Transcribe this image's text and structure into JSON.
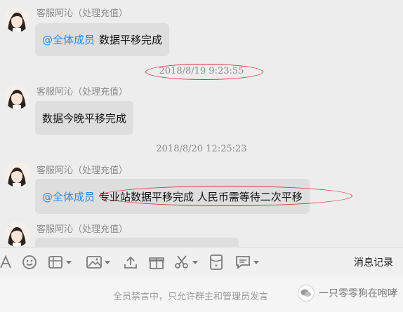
{
  "messages": [
    {
      "sender": "客服阿沁（处理充值）",
      "mention": "@全体成员",
      "text": "数据平移完成"
    },
    {
      "time": "2018/8/19 9:23:55"
    },
    {
      "sender": "客服阿沁（处理充值）",
      "text": "数据今晚平移完成"
    },
    {
      "time": "2018/8/20 12:25:23"
    },
    {
      "sender": "客服阿沁（处理充值）",
      "mention": "@全体成员",
      "text": "专业站数据平移完成 人民币需等待二次平移"
    },
    {
      "sender": "客服阿沁（处理充值）"
    }
  ],
  "toolbar": {
    "icons": [
      "font-icon",
      "emoji-icon",
      "sticker-icon",
      "image-icon",
      "upload-icon",
      "gift-icon",
      "screenshot-icon",
      "redpacket-icon",
      "chat-record-icon"
    ],
    "history_label": "消息记录"
  },
  "footer": {
    "banned_text": "全员禁言中，只允许群主和管理员发言",
    "watermark": "一只零零狗在咆哮"
  },
  "colors": {
    "mention": "#2b8ae0",
    "annotation": "#d8353a",
    "bubble": "#dedede"
  }
}
